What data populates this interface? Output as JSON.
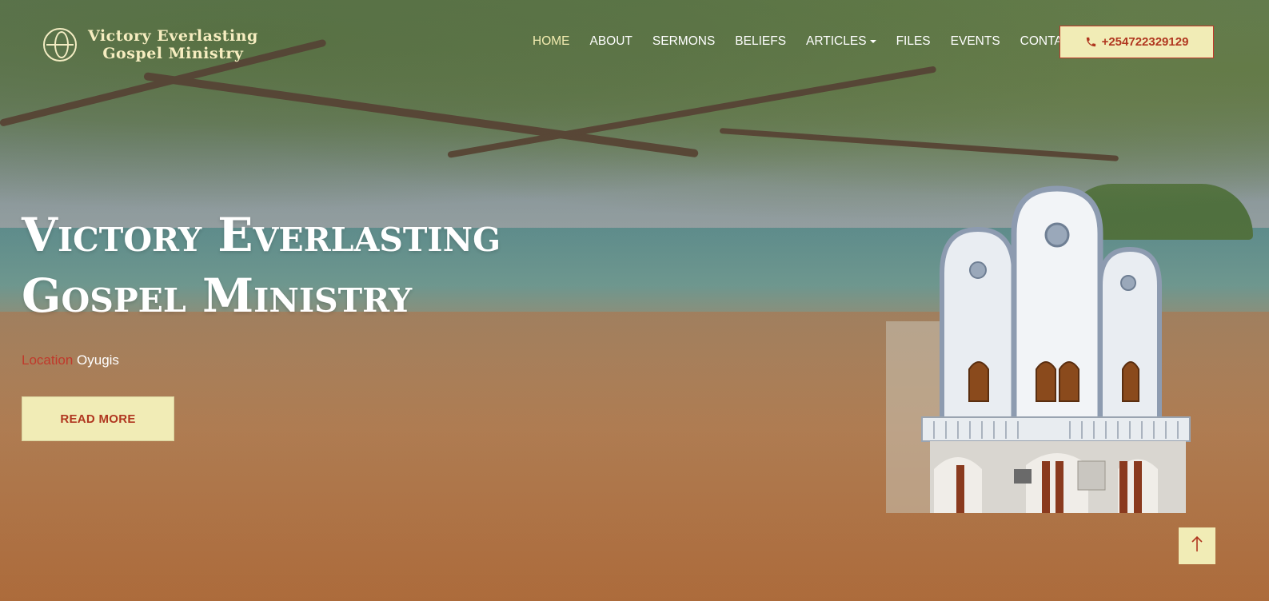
{
  "brand": {
    "line1": "Victory Everlasting",
    "line2": "Gospel Ministry"
  },
  "nav": {
    "items": [
      {
        "label": "HOME",
        "active": true
      },
      {
        "label": "ABOUT"
      },
      {
        "label": "SERMONS"
      },
      {
        "label": "BELIEFS"
      },
      {
        "label": "ARTICLES",
        "dropdown": true
      },
      {
        "label": "FILES"
      },
      {
        "label": "EVENTS"
      },
      {
        "label": "CONTACTS"
      }
    ],
    "phone": "+254722329129"
  },
  "hero": {
    "title_line1": "Victory Everlasting",
    "title_line2": "Gospel Ministry",
    "location_label": "Location",
    "location_value": "Oyugis",
    "cta": "READ MORE"
  },
  "colors": {
    "accent": "#c0392b",
    "button_bg": "#f1ecb6",
    "nav_active": "#f3ecb0"
  },
  "icons": {
    "phone": "phone-icon",
    "scroll_top": "arrow-up-icon",
    "logo": "globe-icon"
  }
}
